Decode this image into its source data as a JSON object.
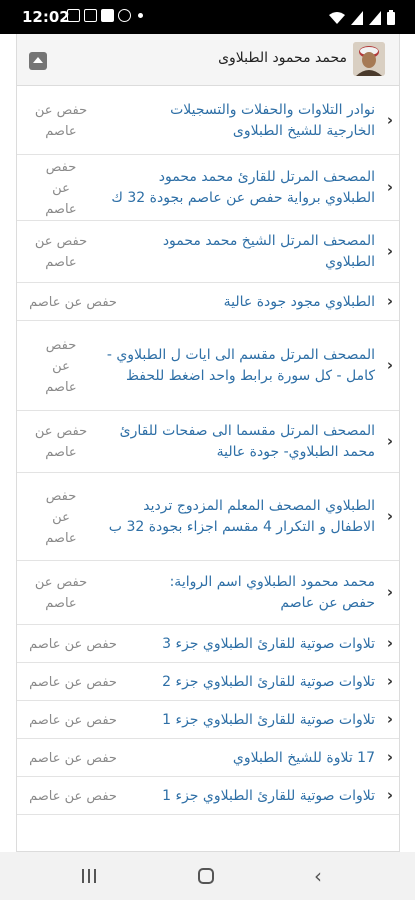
{
  "status_bar": {
    "time": "12:02",
    "left_icons": [
      "gallery-icon",
      "image-icon",
      "download-icon",
      "whatsapp-icon",
      "notification-dot-icon"
    ],
    "right_icons": [
      "wifi-icon",
      "signal-icon",
      "signal-icon",
      "battery-icon"
    ]
  },
  "header": {
    "title": "محمد محمود الطبلاوى",
    "avatar_icon": "reciter-avatar",
    "collapse_icon": "collapse-up-icon"
  },
  "items": [
    {
      "title_lines": [
        "نوادر التلاوات والحفلات والتسجيلات",
        "الخارجية للشيخ الطبلاوى"
      ],
      "narration_lines": [
        "حفص عن",
        "عاصم"
      ]
    },
    {
      "title_lines": [
        "المصحف المرتل للقارئ محمد محمود",
        "الطبلاوي برواية حفص عن عاصم بجودة 32 ك"
      ],
      "narration_lines": [
        "حفص",
        "عن",
        "عاصم"
      ]
    },
    {
      "title_lines": [
        "المصحف المرتل الشيخ محمد محمود",
        "الطبلاوي"
      ],
      "narration_lines": [
        "حفص عن",
        "عاصم"
      ]
    },
    {
      "title_lines": [
        "الطبلاوي مجود جودة عالية"
      ],
      "narration_lines": [
        "حفص عن عاصم"
      ]
    },
    {
      "title_lines": [
        "المصحف المرتل مقسم الى ايات ل الطبلاوي -",
        "كامل - كل سورة برابط واحد اضغط للحفظ"
      ],
      "narration_lines": [
        "حفص",
        "عن",
        "عاصم"
      ]
    },
    {
      "title_lines": [
        "المصحف المرتل مقسما الى صفحات للقارئ",
        "محمد الطبلاوي- جودة عالية"
      ],
      "narration_lines": [
        "حفص عن",
        "عاصم"
      ]
    },
    {
      "title_lines": [
        "الطبلاوي المصحف المعلم المزدوج ترديد",
        "الاطفال و التكرار 4 مقسم اجزاء بجودة 32 ب"
      ],
      "narration_lines": [
        "حفص",
        "عن",
        "عاصم"
      ]
    },
    {
      "title_lines": [
        "محمد محمود الطبلاوي اسم الرواية:",
        "حفص عن عاصم"
      ],
      "narration_lines": [
        "حفص عن",
        "عاصم"
      ]
    },
    {
      "title_lines": [
        "تلاوات صوتية للقارئ الطبلاوي جزء 3"
      ],
      "narration_lines": [
        "حفص عن عاصم"
      ]
    },
    {
      "title_lines": [
        "تلاوات صوتية للقارئ الطبلاوي جزء 2"
      ],
      "narration_lines": [
        "حفص عن عاصم"
      ]
    },
    {
      "title_lines": [
        "تلاوات صوتية للقارئ الطبلاوي جزء 1"
      ],
      "narration_lines": [
        "حفص عن عاصم"
      ]
    },
    {
      "title_lines": [
        "17 تلاوة للشيخ الطبلاوي"
      ],
      "narration_lines": [
        "حفص عن عاصم"
      ]
    },
    {
      "title_lines": [
        "تلاوات صوتية للقارئ الطبلاوي جزء 1"
      ],
      "narration_lines": [
        "حفص عن عاصم"
      ]
    }
  ],
  "nav_bar": {
    "icons": [
      "recent-apps-icon",
      "home-icon",
      "back-icon"
    ]
  },
  "colors": {
    "link": "#2e6fa6",
    "muted": "#8a8a8a",
    "header_bg": "#f5f5f5"
  }
}
